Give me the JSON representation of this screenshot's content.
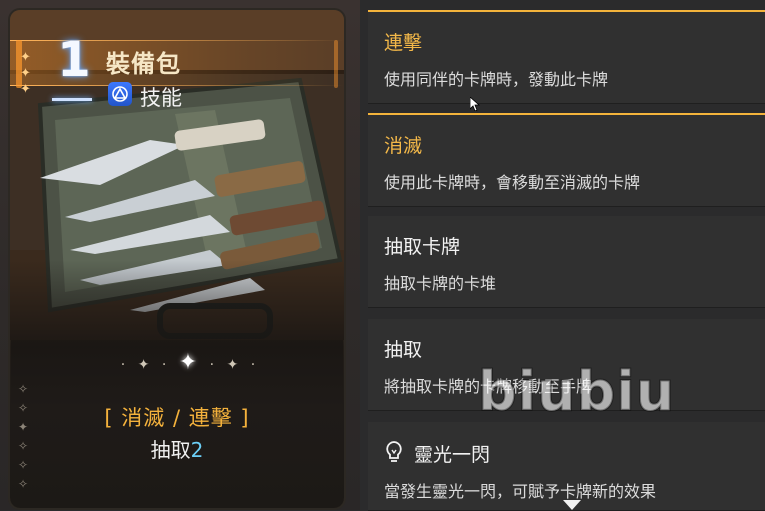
{
  "card": {
    "cost": "1",
    "name": "裝備包",
    "type": "技能",
    "type_icon": "skill-triangle-icon",
    "keywords": "[ 消滅 / 連擊 ]",
    "effect_label": "抽取",
    "effect_value": "2",
    "divider_ornament": "sparkle-divider",
    "art": "case-of-knives"
  },
  "panels": [
    {
      "title": "連擊",
      "desc": "使用同伴的卡牌時，發動此卡牌",
      "highlight": true
    },
    {
      "title": "消滅",
      "desc": "使用此卡牌時，會移動至消滅的卡牌",
      "highlight": true
    },
    {
      "title": "抽取卡牌",
      "desc": "抽取卡牌的卡堆",
      "highlight": false
    },
    {
      "title": "抽取",
      "desc": "將抽取卡牌的卡牌移動至手牌",
      "highlight": false
    },
    {
      "title": "靈光一閃",
      "desc": "當發生靈光一閃，可賦予卡牌新的效果",
      "highlight": false,
      "icon": "lightbulb-icon"
    }
  ],
  "watermark": "biubiu",
  "colors": {
    "accent_gold": "#f3b849",
    "keyword_orange": "#f4b23c",
    "number_cyan": "#6ccff6",
    "panel_bg": "#303030",
    "page_bg": "#2b2b2c"
  }
}
